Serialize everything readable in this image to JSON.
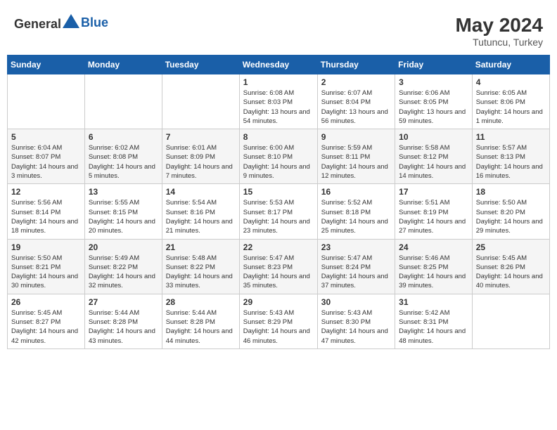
{
  "header": {
    "logo_general": "General",
    "logo_blue": "Blue",
    "month_year": "May 2024",
    "location": "Tutuncu, Turkey"
  },
  "days_of_week": [
    "Sunday",
    "Monday",
    "Tuesday",
    "Wednesday",
    "Thursday",
    "Friday",
    "Saturday"
  ],
  "weeks": [
    [
      {
        "day": "",
        "sunrise": "",
        "sunset": "",
        "daylight": ""
      },
      {
        "day": "",
        "sunrise": "",
        "sunset": "",
        "daylight": ""
      },
      {
        "day": "",
        "sunrise": "",
        "sunset": "",
        "daylight": ""
      },
      {
        "day": "1",
        "sunrise": "Sunrise: 6:08 AM",
        "sunset": "Sunset: 8:03 PM",
        "daylight": "Daylight: 13 hours and 54 minutes."
      },
      {
        "day": "2",
        "sunrise": "Sunrise: 6:07 AM",
        "sunset": "Sunset: 8:04 PM",
        "daylight": "Daylight: 13 hours and 56 minutes."
      },
      {
        "day": "3",
        "sunrise": "Sunrise: 6:06 AM",
        "sunset": "Sunset: 8:05 PM",
        "daylight": "Daylight: 13 hours and 59 minutes."
      },
      {
        "day": "4",
        "sunrise": "Sunrise: 6:05 AM",
        "sunset": "Sunset: 8:06 PM",
        "daylight": "Daylight: 14 hours and 1 minute."
      }
    ],
    [
      {
        "day": "5",
        "sunrise": "Sunrise: 6:04 AM",
        "sunset": "Sunset: 8:07 PM",
        "daylight": "Daylight: 14 hours and 3 minutes."
      },
      {
        "day": "6",
        "sunrise": "Sunrise: 6:02 AM",
        "sunset": "Sunset: 8:08 PM",
        "daylight": "Daylight: 14 hours and 5 minutes."
      },
      {
        "day": "7",
        "sunrise": "Sunrise: 6:01 AM",
        "sunset": "Sunset: 8:09 PM",
        "daylight": "Daylight: 14 hours and 7 minutes."
      },
      {
        "day": "8",
        "sunrise": "Sunrise: 6:00 AM",
        "sunset": "Sunset: 8:10 PM",
        "daylight": "Daylight: 14 hours and 9 minutes."
      },
      {
        "day": "9",
        "sunrise": "Sunrise: 5:59 AM",
        "sunset": "Sunset: 8:11 PM",
        "daylight": "Daylight: 14 hours and 12 minutes."
      },
      {
        "day": "10",
        "sunrise": "Sunrise: 5:58 AM",
        "sunset": "Sunset: 8:12 PM",
        "daylight": "Daylight: 14 hours and 14 minutes."
      },
      {
        "day": "11",
        "sunrise": "Sunrise: 5:57 AM",
        "sunset": "Sunset: 8:13 PM",
        "daylight": "Daylight: 14 hours and 16 minutes."
      }
    ],
    [
      {
        "day": "12",
        "sunrise": "Sunrise: 5:56 AM",
        "sunset": "Sunset: 8:14 PM",
        "daylight": "Daylight: 14 hours and 18 minutes."
      },
      {
        "day": "13",
        "sunrise": "Sunrise: 5:55 AM",
        "sunset": "Sunset: 8:15 PM",
        "daylight": "Daylight: 14 hours and 20 minutes."
      },
      {
        "day": "14",
        "sunrise": "Sunrise: 5:54 AM",
        "sunset": "Sunset: 8:16 PM",
        "daylight": "Daylight: 14 hours and 21 minutes."
      },
      {
        "day": "15",
        "sunrise": "Sunrise: 5:53 AM",
        "sunset": "Sunset: 8:17 PM",
        "daylight": "Daylight: 14 hours and 23 minutes."
      },
      {
        "day": "16",
        "sunrise": "Sunrise: 5:52 AM",
        "sunset": "Sunset: 8:18 PM",
        "daylight": "Daylight: 14 hours and 25 minutes."
      },
      {
        "day": "17",
        "sunrise": "Sunrise: 5:51 AM",
        "sunset": "Sunset: 8:19 PM",
        "daylight": "Daylight: 14 hours and 27 minutes."
      },
      {
        "day": "18",
        "sunrise": "Sunrise: 5:50 AM",
        "sunset": "Sunset: 8:20 PM",
        "daylight": "Daylight: 14 hours and 29 minutes."
      }
    ],
    [
      {
        "day": "19",
        "sunrise": "Sunrise: 5:50 AM",
        "sunset": "Sunset: 8:21 PM",
        "daylight": "Daylight: 14 hours and 30 minutes."
      },
      {
        "day": "20",
        "sunrise": "Sunrise: 5:49 AM",
        "sunset": "Sunset: 8:22 PM",
        "daylight": "Daylight: 14 hours and 32 minutes."
      },
      {
        "day": "21",
        "sunrise": "Sunrise: 5:48 AM",
        "sunset": "Sunset: 8:22 PM",
        "daylight": "Daylight: 14 hours and 33 minutes."
      },
      {
        "day": "22",
        "sunrise": "Sunrise: 5:47 AM",
        "sunset": "Sunset: 8:23 PM",
        "daylight": "Daylight: 14 hours and 35 minutes."
      },
      {
        "day": "23",
        "sunrise": "Sunrise: 5:47 AM",
        "sunset": "Sunset: 8:24 PM",
        "daylight": "Daylight: 14 hours and 37 minutes."
      },
      {
        "day": "24",
        "sunrise": "Sunrise: 5:46 AM",
        "sunset": "Sunset: 8:25 PM",
        "daylight": "Daylight: 14 hours and 39 minutes."
      },
      {
        "day": "25",
        "sunrise": "Sunrise: 5:45 AM",
        "sunset": "Sunset: 8:26 PM",
        "daylight": "Daylight: 14 hours and 40 minutes."
      }
    ],
    [
      {
        "day": "26",
        "sunrise": "Sunrise: 5:45 AM",
        "sunset": "Sunset: 8:27 PM",
        "daylight": "Daylight: 14 hours and 42 minutes."
      },
      {
        "day": "27",
        "sunrise": "Sunrise: 5:44 AM",
        "sunset": "Sunset: 8:28 PM",
        "daylight": "Daylight: 14 hours and 43 minutes."
      },
      {
        "day": "28",
        "sunrise": "Sunrise: 5:44 AM",
        "sunset": "Sunset: 8:28 PM",
        "daylight": "Daylight: 14 hours and 44 minutes."
      },
      {
        "day": "29",
        "sunrise": "Sunrise: 5:43 AM",
        "sunset": "Sunset: 8:29 PM",
        "daylight": "Daylight: 14 hours and 46 minutes."
      },
      {
        "day": "30",
        "sunrise": "Sunrise: 5:43 AM",
        "sunset": "Sunset: 8:30 PM",
        "daylight": "Daylight: 14 hours and 47 minutes."
      },
      {
        "day": "31",
        "sunrise": "Sunrise: 5:42 AM",
        "sunset": "Sunset: 8:31 PM",
        "daylight": "Daylight: 14 hours and 48 minutes."
      },
      {
        "day": "",
        "sunrise": "",
        "sunset": "",
        "daylight": ""
      }
    ]
  ]
}
